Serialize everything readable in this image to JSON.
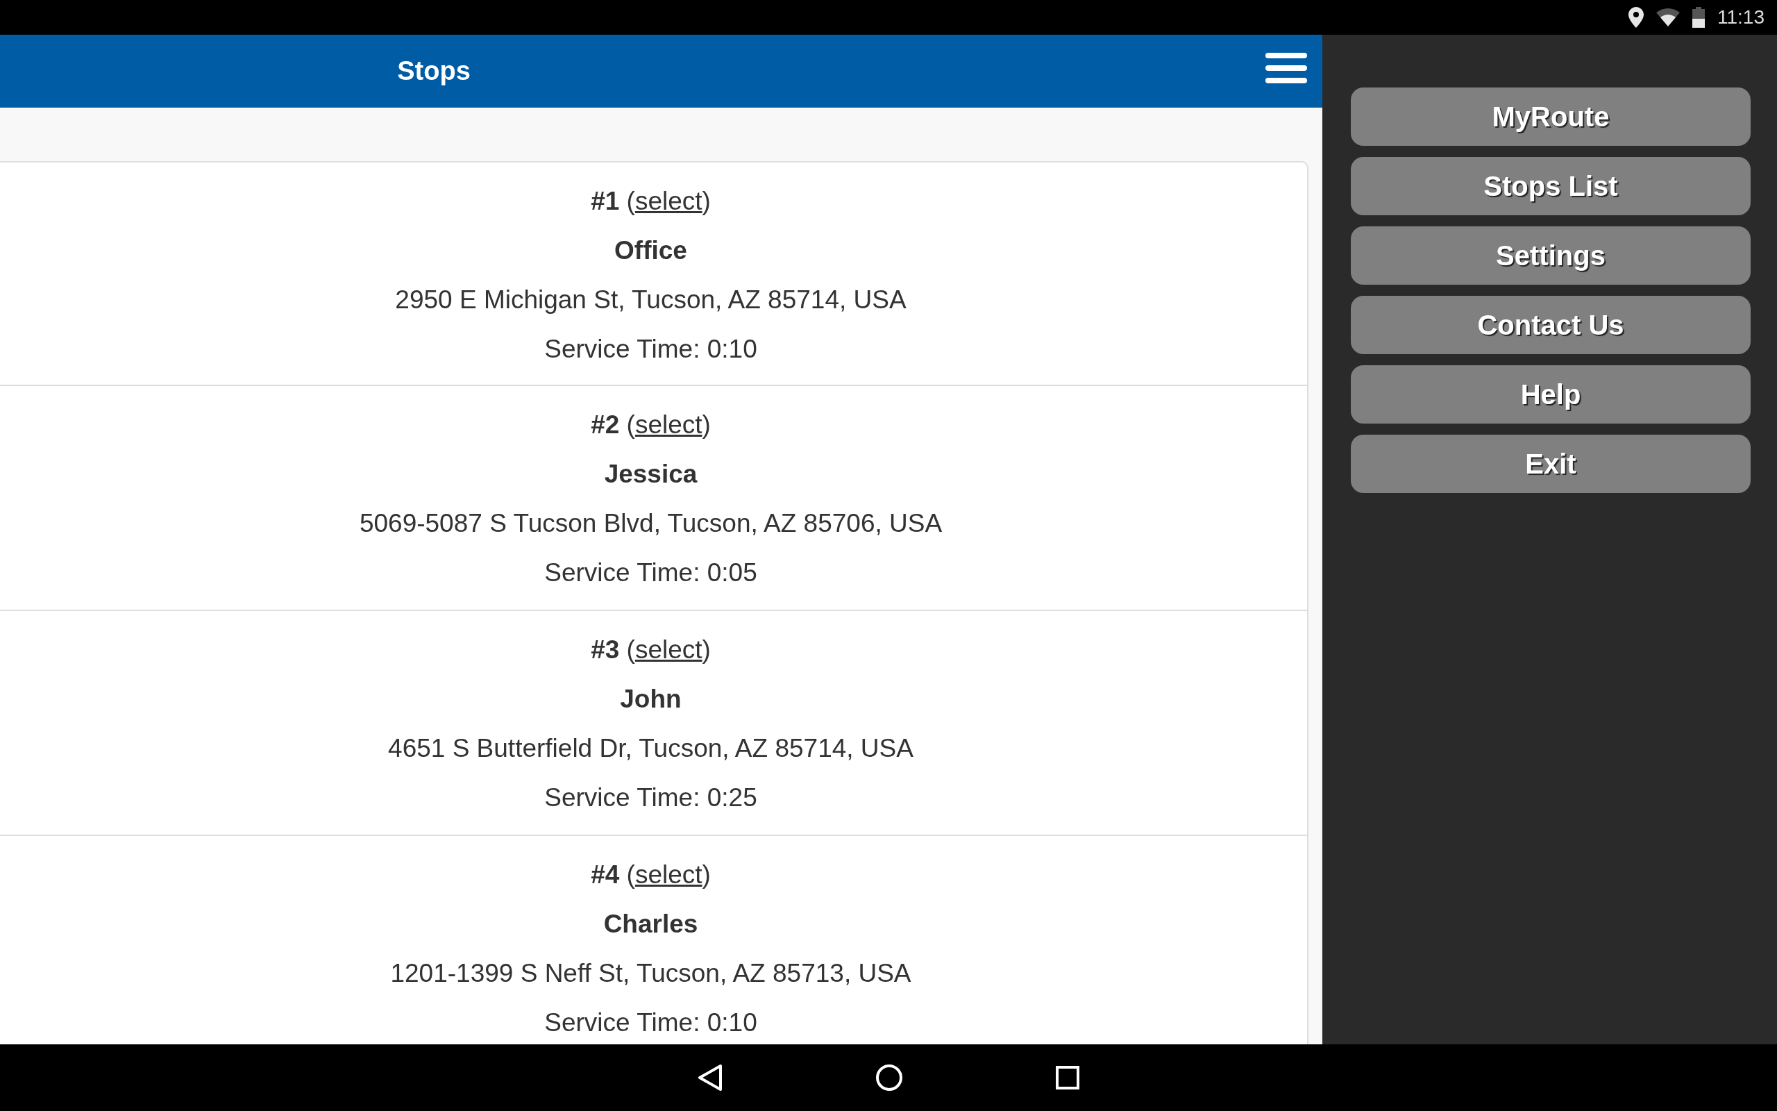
{
  "status_bar": {
    "time": "11:13"
  },
  "header": {
    "title": "Stops"
  },
  "stops": [
    {
      "heading_prefix": "**#1** (",
      "link": "select",
      "heading_suffix": ")",
      "name": "Office",
      "address": "2950 E Michigan St, Tucson, AZ 85714, USA",
      "service_time": "Service Time: 0:10"
    },
    {
      "heading_prefix": "**#2** (",
      "link": "select",
      "heading_suffix": ")",
      "name": "Jessica",
      "address": "5069-5087 S Tucson Blvd, Tucson, AZ 85706, USA",
      "service_time": "Service Time: 0:05"
    },
    {
      "heading_prefix": "**#3** (",
      "link": "select",
      "heading_suffix": ")",
      "name": "John",
      "address": "4651 S Butterfield Dr, Tucson, AZ 85714, USA",
      "service_time": "Service Time: 0:25"
    },
    {
      "heading_prefix": "**#4** (",
      "link": "select",
      "heading_suffix": ")",
      "name": "Charles",
      "address": "1201-1399 S Neff St, Tucson, AZ 85713, USA",
      "service_time": "Service Time: 0:10"
    }
  ],
  "menu": [
    "MyRoute",
    "Stops List",
    "Settings",
    "Contact Us",
    "Help",
    "Exit"
  ]
}
